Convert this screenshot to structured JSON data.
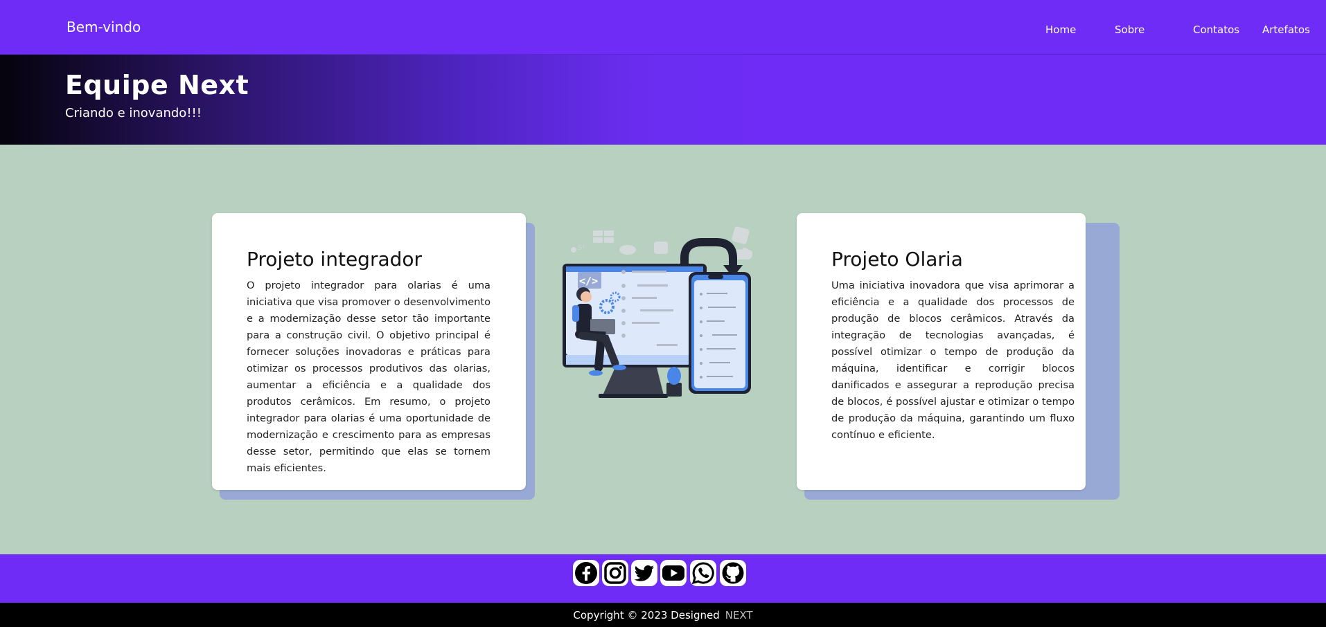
{
  "nav": {
    "brand": "Bem-vindo",
    "links": [
      "Home",
      "Sobre",
      "Contatos",
      "Artefatos"
    ]
  },
  "hero": {
    "title": "Equipe Next",
    "subtitle": "Criando e inovando!!!"
  },
  "cards": [
    {
      "title": "Projeto integrador",
      "body": "O projeto integrador para olarias é uma iniciativa que visa promover o desenvolvimento e a modernização desse setor tão importante para a construção civil. O objetivo principal é fornecer soluções inovadoras e práticas para otimizar os processos produtivos das olarias, aumentar a eficiência e a qualidade dos produtos cerâmicos. Em resumo, o projeto integrador para olarias é uma oportunidade de modernização e crescimento para as empresas desse setor, permitindo que elas se tornem mais eficientes."
    },
    {
      "title": "Projeto Olaria",
      "body": "Uma iniciativa inovadora que visa aprimorar a eficiência e a qualidade dos processos de produção de blocos cerâmicos. Através da integração de tecnologias avançadas, é possível otimizar o tempo de produção da máquina, identificar e corrigir blocos danificados e assegurar a reprodução precisa de blocos, é possível ajustar e otimizar o tempo de produção da máquina, garantindo um fluxo contínuo e eficiente."
    }
  ],
  "illustration": {
    "icon": "developer-illustration",
    "code_tag": "</>"
  },
  "social_icons": [
    "facebook-icon",
    "instagram-icon",
    "twitter-icon",
    "youtube-icon",
    "whatsapp-icon",
    "github-icon"
  ],
  "footer": {
    "copyright": "Copyright © 2023 Designed",
    "brand": "NEXT"
  },
  "colors": {
    "primary": "#6f2cf7",
    "background": "#b8d0c0",
    "card_shadow": "#98a9d6",
    "footer_bottom": "#000000"
  }
}
